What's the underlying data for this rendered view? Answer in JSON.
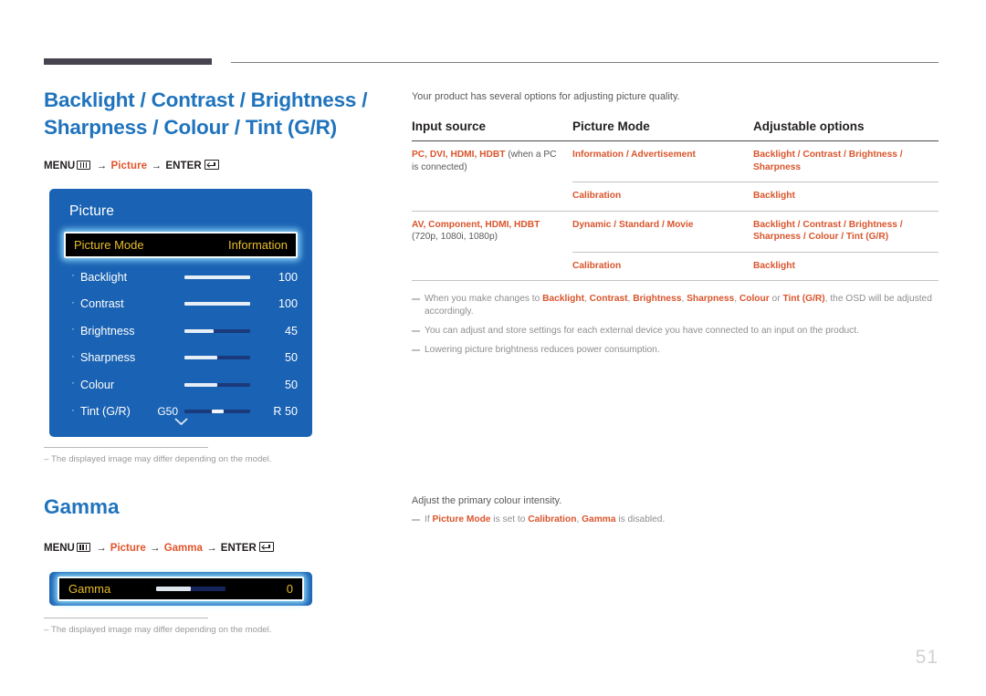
{
  "page": {
    "number": "51"
  },
  "left": {
    "section_title": "Backlight / Contrast / Brightness / Sharpness / Colour / Tint (G/R)",
    "menu_path": {
      "menu_label": "MENU",
      "menu_icon": "menu-icon",
      "arrow": "→",
      "step1": "Picture",
      "enter_label": "ENTER",
      "enter_icon": "enter-icon"
    },
    "osd": {
      "title": "Picture",
      "highlight": {
        "label": "Picture Mode",
        "value": "Information"
      },
      "rows": [
        {
          "label": "Backlight",
          "value": "100",
          "fill_pct": 100,
          "left_label": "",
          "right_label": "",
          "style": "fill"
        },
        {
          "label": "Contrast",
          "value": "100",
          "fill_pct": 100,
          "left_label": "",
          "right_label": "",
          "style": "fill"
        },
        {
          "label": "Brightness",
          "value": "45",
          "fill_pct": 45,
          "left_label": "",
          "right_label": "",
          "style": "fill"
        },
        {
          "label": "Sharpness",
          "value": "50",
          "fill_pct": 50,
          "left_label": "",
          "right_label": "",
          "style": "fill"
        },
        {
          "label": "Colour",
          "value": "50",
          "fill_pct": 50,
          "left_label": "",
          "right_label": "",
          "style": "fill"
        },
        {
          "label": "Tint (G/R)",
          "value": "R 50",
          "fill_pct": 50,
          "left_label": "G50",
          "right_label": "",
          "style": "knob"
        }
      ],
      "scroll_chevron": "chevron-down-icon"
    },
    "osd_note": "The displayed image may differ depending on the model.",
    "gamma": {
      "section_title": "Gamma",
      "menu_path": {
        "menu_label": "MENU",
        "arrow": "→",
        "step1": "Picture",
        "step2": "Gamma",
        "enter_label": "ENTER"
      },
      "osd": {
        "label": "Gamma",
        "value": "0",
        "fill_pct": 50
      },
      "note": "The displayed image may differ depending on the model."
    }
  },
  "right": {
    "intro": "Your product has several options for adjusting picture quality.",
    "table": {
      "headers": [
        "Input source",
        "Picture Mode",
        "Adjustable options"
      ],
      "rows": [
        {
          "source_bold": "PC, DVI, HDMI, HDBT",
          "source_plain": " (when a PC is connected)",
          "mode": "Information / Advertisement",
          "options": "Backlight / Contrast / Brightness / Sharpness",
          "separator": "none"
        },
        {
          "source_bold": "",
          "source_plain": "",
          "mode": "Calibration",
          "options": "Backlight",
          "separator": "partial"
        },
        {
          "source_bold": "AV, Component, HDMI, HDBT",
          "source_plain": " (720p, 1080i, 1080p)",
          "mode": "Dynamic / Standard / Movie",
          "options": "Backlight / Contrast / Brightness / Sharpness / Colour / Tint (G/R)",
          "separator": "full"
        },
        {
          "source_bold": "",
          "source_plain": "",
          "mode": "Calibration",
          "options": "Backlight",
          "separator": "partial"
        }
      ]
    },
    "notes": [
      {
        "parts": [
          {
            "t": "When you make changes to ",
            "hl": false
          },
          {
            "t": "Backlight",
            "hl": true
          },
          {
            "t": ", ",
            "hl": false
          },
          {
            "t": "Contrast",
            "hl": true
          },
          {
            "t": ", ",
            "hl": false
          },
          {
            "t": "Brightness",
            "hl": true
          },
          {
            "t": ", ",
            "hl": false
          },
          {
            "t": "Sharpness",
            "hl": true
          },
          {
            "t": ", ",
            "hl": false
          },
          {
            "t": "Colour",
            "hl": true
          },
          {
            "t": " or ",
            "hl": false
          },
          {
            "t": "Tint (G/R)",
            "hl": true
          },
          {
            "t": ", the OSD will be adjusted accordingly.",
            "hl": false
          }
        ]
      },
      {
        "parts": [
          {
            "t": "You can adjust and store settings for each external device you have connected to an input on the product.",
            "hl": false
          }
        ]
      },
      {
        "parts": [
          {
            "t": "Lowering picture brightness reduces power consumption.",
            "hl": false
          }
        ]
      }
    ],
    "gamma_desc": {
      "line1": "Adjust the primary colour intensity.",
      "note_parts": [
        {
          "t": "If ",
          "hl": false
        },
        {
          "t": "Picture Mode",
          "hl": true
        },
        {
          "t": " is set to ",
          "hl": false
        },
        {
          "t": "Calibration",
          "hl": true
        },
        {
          "t": ", ",
          "hl": false
        },
        {
          "t": "Gamma",
          "hl": true
        },
        {
          "t": " is disabled.",
          "hl": false
        }
      ]
    }
  }
}
